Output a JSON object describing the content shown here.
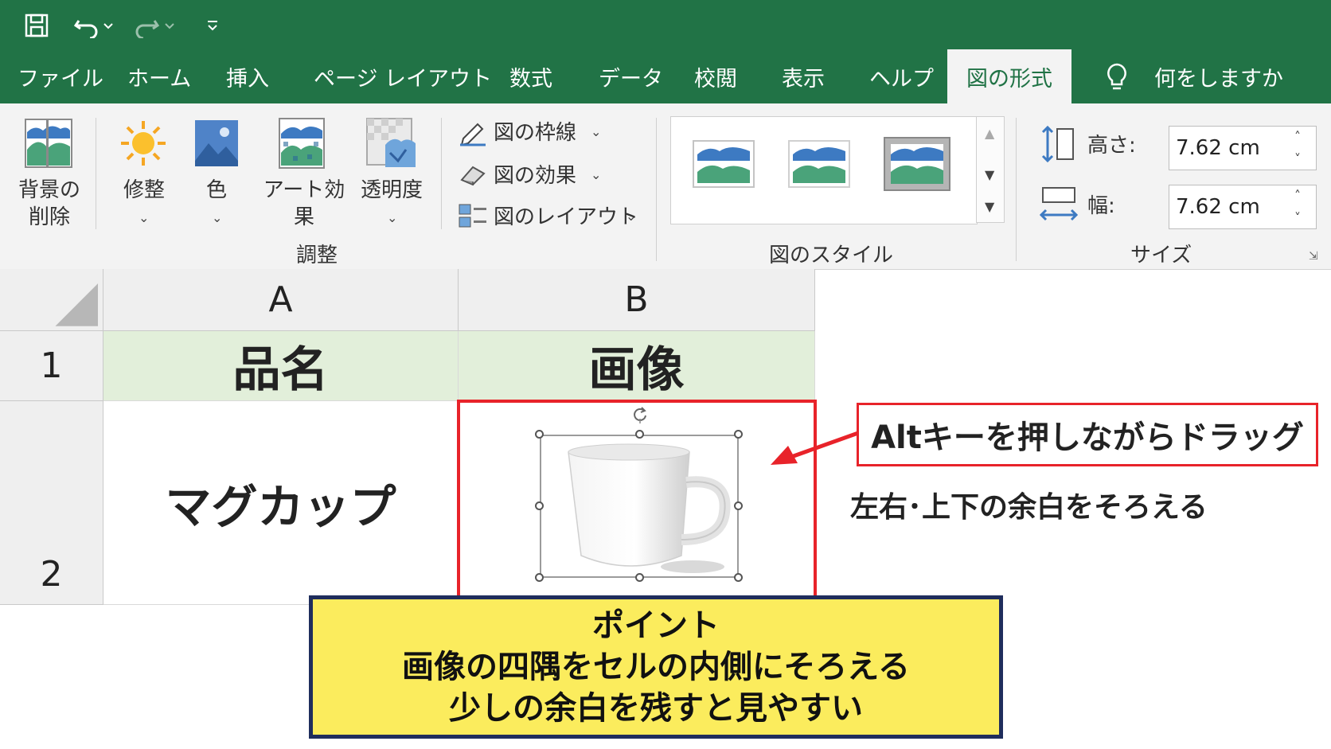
{
  "ribbon_tabs": [
    "ファイル",
    "ホーム",
    "挿入",
    "ページ レイアウト",
    "数式",
    "データ",
    "校閲",
    "表示",
    "ヘルプ"
  ],
  "active_tab": "図の形式",
  "tell_me": "何をしますか",
  "adjust": {
    "remove_bg_line1": "背景の",
    "remove_bg_line2": "削除",
    "corrections": "修整",
    "color": "色",
    "art_effects": "アート効果",
    "transparency": "透明度",
    "group_label": "調整"
  },
  "picture_menu": {
    "border": "図の枠線",
    "effects": "図の効果",
    "layout": "図のレイアウト"
  },
  "styles_group_label": "図のスタイル",
  "size": {
    "height_label": "高さ:",
    "height_value": "7.62 cm",
    "width_label": "幅:",
    "width_value": "7.62 cm",
    "group_label": "サイズ"
  },
  "sheet": {
    "col_a": "A",
    "col_b": "B",
    "row1": "1",
    "row2": "2",
    "a1": "品名",
    "b1": "画像",
    "a2": "マグカップ"
  },
  "callout_drag": "Altキーを押しながらドラッグ",
  "note_margin": "左右･上下の余白をそろえる",
  "point_box": {
    "line1": "ポイント",
    "line2": "画像の四隅をセルの内側にそろえる",
    "line3": "少しの余白を残すと見やすい"
  },
  "colors": {
    "excel_green": "#217346",
    "header_fill": "#e2efda",
    "highlight_red": "#e8232a",
    "point_yellow": "#fbec5d",
    "point_border": "#1f2d5c"
  }
}
